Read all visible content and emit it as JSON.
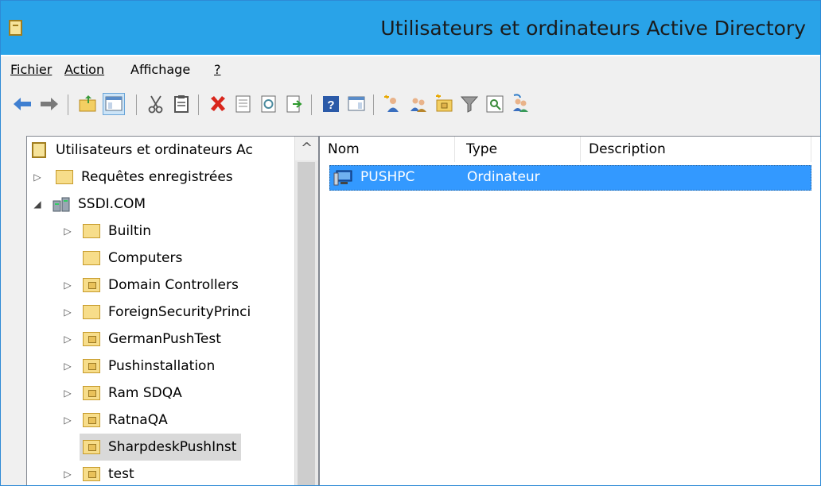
{
  "window": {
    "title": "Utilisateurs et ordinateurs Active Directory"
  },
  "menu": [
    {
      "label": "Fichier"
    },
    {
      "label": "Action"
    },
    {
      "label": "Affichage"
    },
    {
      "label": "?"
    }
  ],
  "toolbar": {
    "icons": [
      "back-arrow-icon",
      "forward-arrow-icon",
      "up-folder-icon",
      "console-tree-icon",
      "cut-icon",
      "copy-icon",
      "delete-icon",
      "properties-icon",
      "refresh-icon",
      "export-list-icon",
      "help-icon",
      "action-pane-icon",
      "new-user-icon",
      "new-group-icon",
      "new-ou-icon",
      "filter-icon",
      "find-icon",
      "add-to-group-icon"
    ]
  },
  "tree": {
    "root": "Utilisateurs et ordinateurs Ac",
    "items": [
      {
        "label": "Requêtes enregistrées",
        "expander": "▷"
      },
      {
        "label": "SSDI.COM",
        "expander": "◢"
      },
      {
        "label": "Builtin",
        "expander": "▷"
      },
      {
        "label": "Computers",
        "expander": ""
      },
      {
        "label": "Domain Controllers",
        "expander": "▷"
      },
      {
        "label": "ForeignSecurityPrinci",
        "expander": "▷"
      },
      {
        "label": "GermanPushTest",
        "expander": "▷"
      },
      {
        "label": "Pushinstallation",
        "expander": "▷"
      },
      {
        "label": "Ram SDQA",
        "expander": "▷"
      },
      {
        "label": "RatnaQA",
        "expander": "▷"
      },
      {
        "label": "SharpdeskPushInst",
        "expander": ""
      },
      {
        "label": "test",
        "expander": "▷"
      }
    ],
    "scroll_up": "^"
  },
  "list": {
    "columns": [
      "Nom",
      "Type",
      "Description"
    ],
    "rows": [
      {
        "name": "PUSHPC",
        "type": "Ordinateur",
        "description": ""
      }
    ]
  },
  "colors": {
    "titlebar": "#29a3e8",
    "selection": "#3399ff"
  }
}
